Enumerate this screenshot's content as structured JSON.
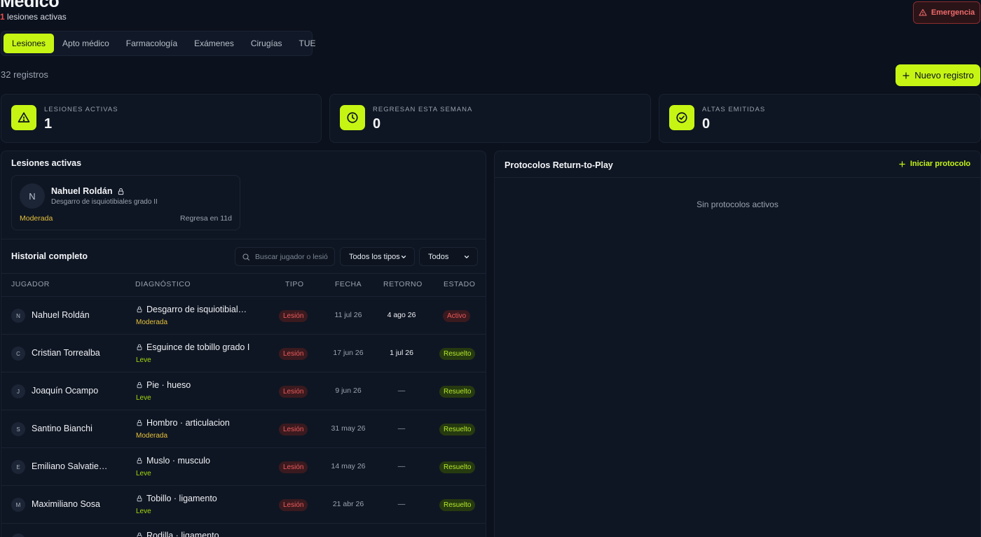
{
  "header": {
    "title": "Médico",
    "active_count": "1",
    "active_label": "lesiones activas",
    "emergency_label": "Emergencia"
  },
  "tabs": [
    {
      "label": "Lesiones",
      "active": true
    },
    {
      "label": "Apto médico"
    },
    {
      "label": "Farmacología"
    },
    {
      "label": "Exámenes"
    },
    {
      "label": "Cirugías"
    },
    {
      "label": "TUE"
    }
  ],
  "records_count": "32 registros",
  "new_record_label": "Nuevo registro",
  "stats": [
    {
      "label": "LESIONES ACTIVAS",
      "value": "1",
      "icon": "warning-icon"
    },
    {
      "label": "REGRESAN ESTA SEMANA",
      "value": "0",
      "icon": "clock-icon"
    },
    {
      "label": "ALTAS EMITIDAS",
      "value": "0",
      "icon": "check-circle-icon"
    }
  ],
  "active_injuries": {
    "title": "Lesiones activas",
    "card": {
      "initial": "N",
      "name": "Nahuel Roldán",
      "diagnosis": "Desgarro de isquiotibiales grado II",
      "severity": "Moderada",
      "return": "Regresa en 11d"
    }
  },
  "history": {
    "title": "Historial completo",
    "search_placeholder": "Buscar jugador o lesió",
    "type_filter": "Todos los tipos",
    "state_filter": "Todos",
    "columns": {
      "player": "JUGADOR",
      "diagnosis": "DIAGNÓSTICO",
      "type": "TIPO",
      "date": "FECHA",
      "return": "RETORNO",
      "state": "ESTADO"
    },
    "rows": [
      {
        "initial": "N",
        "player": "Nahuel Roldán",
        "diagnosis": "Desgarro de isquiotibial…",
        "severity": "Moderada",
        "type": "Lesión",
        "date": "11 jul 26",
        "return": "4 ago 26",
        "state": "Activo"
      },
      {
        "initial": "C",
        "player": "Cristian Torrealba",
        "diagnosis": "Esguince de tobillo grado I",
        "severity": "Leve",
        "type": "Lesión",
        "date": "17 jun 26",
        "return": "1 jul 26",
        "state": "Resuelto"
      },
      {
        "initial": "J",
        "player": "Joaquín Ocampo",
        "diagnosis": "Pie · hueso",
        "severity": "Leve",
        "type": "Lesión",
        "date": "9 jun 26",
        "return": "—",
        "state": "Resuelto"
      },
      {
        "initial": "S",
        "player": "Santino Bianchi",
        "diagnosis": "Hombro · articulacion",
        "severity": "Moderada",
        "type": "Lesión",
        "date": "31 may 26",
        "return": "—",
        "state": "Resuelto"
      },
      {
        "initial": "E",
        "player": "Emiliano Salvatie…",
        "diagnosis": "Muslo · musculo",
        "severity": "Leve",
        "type": "Lesión",
        "date": "14 may 26",
        "return": "—",
        "state": "Resuelto"
      },
      {
        "initial": "M",
        "player": "Maximiliano Sosa",
        "diagnosis": "Tobillo · ligamento",
        "severity": "Leve",
        "type": "Lesión",
        "date": "21 abr 26",
        "return": "—",
        "state": "Resuelto"
      },
      {
        "initial": "",
        "player": "",
        "diagnosis": "Rodilla · ligamento",
        "severity": "",
        "type": "",
        "date": "",
        "return": "",
        "state": ""
      }
    ]
  },
  "protocols": {
    "title": "Protocolos Return-to-Play",
    "start_label": "Iniciar protocolo",
    "empty_text": "Sin protocolos activos"
  },
  "colors": {
    "accent": "#c6f514",
    "danger": "#ee5a5a",
    "moderate": "#e5c03b",
    "background": "#0b111d"
  }
}
